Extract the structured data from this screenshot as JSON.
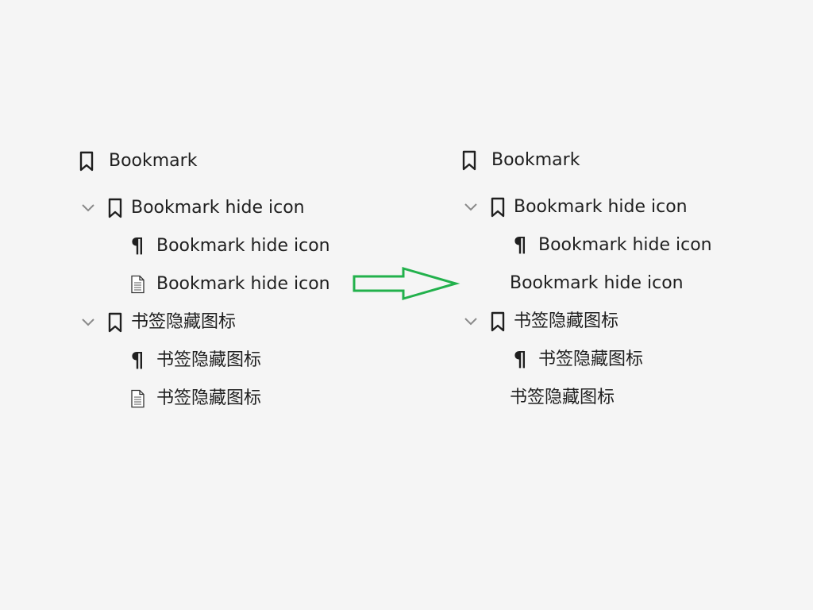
{
  "colors": {
    "background": "#f5f5f5",
    "text": "#1f1f1f",
    "chevron": "#8a8a8a",
    "arrow": "#22b14c"
  },
  "before": {
    "root": {
      "label": "Bookmark",
      "icon": "bookmark-icon"
    },
    "groups": [
      {
        "label": "Bookmark hide icon",
        "icon": "bookmark-icon",
        "expanded": true,
        "children": [
          {
            "label": "Bookmark hide icon",
            "icon": "pilcrow-icon"
          },
          {
            "label": "Bookmark hide icon",
            "icon": "page-icon"
          }
        ]
      },
      {
        "label": "书签隐藏图标",
        "icon": "bookmark-icon",
        "expanded": true,
        "children": [
          {
            "label": "书签隐藏图标",
            "icon": "pilcrow-icon"
          },
          {
            "label": "书签隐藏图标",
            "icon": "page-icon"
          }
        ]
      }
    ]
  },
  "after": {
    "root": {
      "label": "Bookmark",
      "icon": "bookmark-icon"
    },
    "groups": [
      {
        "label": "Bookmark hide icon",
        "icon": "bookmark-icon",
        "expanded": true,
        "children": [
          {
            "label": "Bookmark hide icon",
            "icon": "pilcrow-icon"
          },
          {
            "label": "Bookmark hide icon",
            "icon": "none"
          }
        ]
      },
      {
        "label": "书签隐藏图标",
        "icon": "bookmark-icon",
        "expanded": true,
        "children": [
          {
            "label": "书签隐藏图标",
            "icon": "pilcrow-icon"
          },
          {
            "label": "书签隐藏图标",
            "icon": "none"
          }
        ]
      }
    ]
  },
  "transition": {
    "icon": "right-arrow-icon"
  }
}
